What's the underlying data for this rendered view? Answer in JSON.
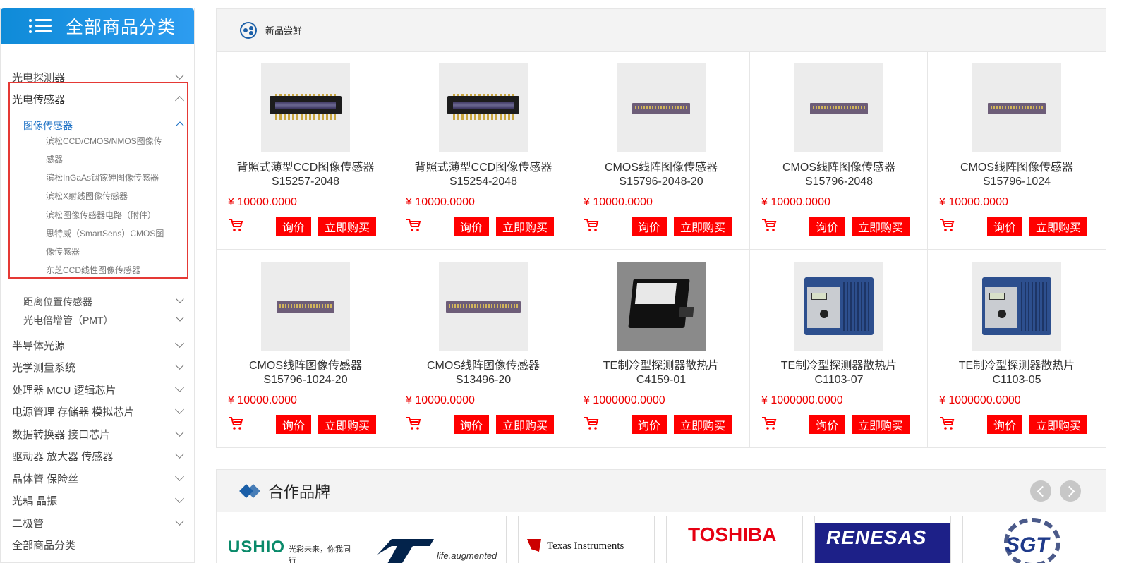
{
  "sidebar": {
    "title": "全部商品分类",
    "categories": [
      "光电探测器",
      "光电传感器",
      "半导体光源",
      "光学测量系统",
      "处理器 MCU 逻辑芯片",
      "电源管理 存储器 模拟芯片",
      "数据转换器 接口芯片",
      "驱动器 放大器 传感器",
      "晶体管 保险丝",
      "光耦 晶振",
      "二极管",
      "全部商品分类"
    ],
    "subcategories": [
      "图像传感器",
      "距离位置传感器",
      "光电倍增管（PMT）"
    ],
    "leaves": [
      "滨松CCD/CMOS/NMOS图像传",
      "感器",
      "滨松InGaAs铟镓砷图像传感器",
      "滨松X射线图像传感器",
      "滨松图像传感器电路（附件）",
      "思特威（SmartSens）CMOS图",
      "像传感器",
      "东芝CCD线性图像传感器"
    ]
  },
  "products": {
    "section_title": "新品尝鲜",
    "inquiry_label": "询价",
    "buy_label": "立即购买",
    "items": [
      {
        "name": "背照式薄型CCD图像传感器",
        "model": "S15257-2048",
        "price": "¥ 10000.0000"
      },
      {
        "name": "背照式薄型CCD图像传感器",
        "model": "S15254-2048",
        "price": "¥ 10000.0000"
      },
      {
        "name": "CMOS线阵图像传感器",
        "model": "S15796-2048-20",
        "price": "¥ 10000.0000"
      },
      {
        "name": "CMOS线阵图像传感器",
        "model": "S15796-2048",
        "price": "¥ 10000.0000"
      },
      {
        "name": "CMOS线阵图像传感器",
        "model": "S15796-1024",
        "price": "¥ 10000.0000"
      },
      {
        "name": "CMOS线阵图像传感器",
        "model": "S15796-1024-20",
        "price": "¥ 10000.0000"
      },
      {
        "name": "CMOS线阵图像传感器",
        "model": "S13496-20",
        "price": "¥ 10000.0000"
      },
      {
        "name": "TE制冷型探测器散热片",
        "model": "C4159-01",
        "price": "¥ 1000000.0000"
      },
      {
        "name": "TE制冷型探测器散热片",
        "model": "C1103-07",
        "price": "¥ 1000000.0000"
      },
      {
        "name": "TE制冷型探测器散热片",
        "model": "C1103-05",
        "price": "¥ 1000000.0000"
      }
    ]
  },
  "brands": {
    "title": "合作品牌",
    "logos": {
      "usio": "USHIO",
      "usio_tag": "光彩未来，你我同行",
      "st_tag": "life.augmented",
      "ti": "Texas Instruments",
      "toshiba": "TOSHIBA",
      "renesas": "RENESAS",
      "sgt": "SGT"
    }
  },
  "colors": {
    "accent_blue": "#1a8ee0",
    "price_red": "#ee0000",
    "button_red": "#ff0000",
    "highlight_border": "#e53935"
  }
}
